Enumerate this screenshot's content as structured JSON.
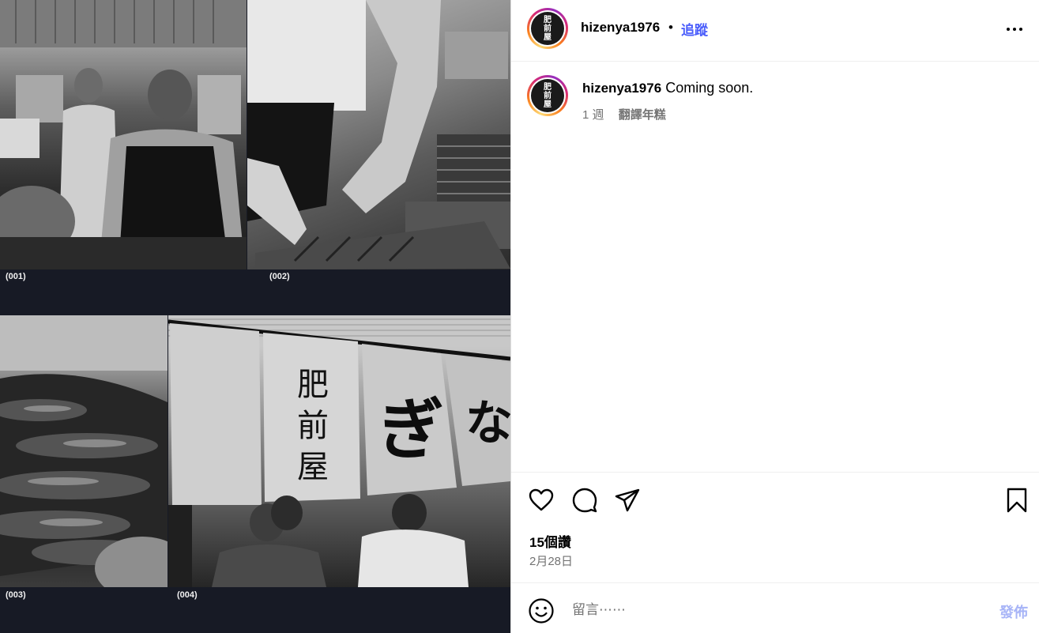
{
  "post": {
    "username": "hizenya1976",
    "separator": "•",
    "follow_label": "追蹤",
    "caption": "Coming soon.",
    "age": "1 週",
    "translate_label": "翻譯年糕",
    "likes": "15個讚",
    "date": "2月28日"
  },
  "avatar": {
    "logo_text": "肥前屋"
  },
  "media": {
    "captions": [
      "(001)",
      "(002)",
      "(003)",
      "(004)"
    ],
    "noren_text": [
      "肥",
      "前",
      "屋",
      "ぎ",
      "な"
    ]
  },
  "comment": {
    "placeholder": "留言⋯⋯",
    "post_label": "發佈"
  },
  "colors": {
    "accent": "#4a5dfb",
    "post_disabled": "#a7b4f7",
    "media_background": "#171a25"
  },
  "icons": [
    "more-options-icon",
    "heart-icon",
    "comment-icon",
    "share-icon",
    "bookmark-icon",
    "emoji-icon"
  ]
}
